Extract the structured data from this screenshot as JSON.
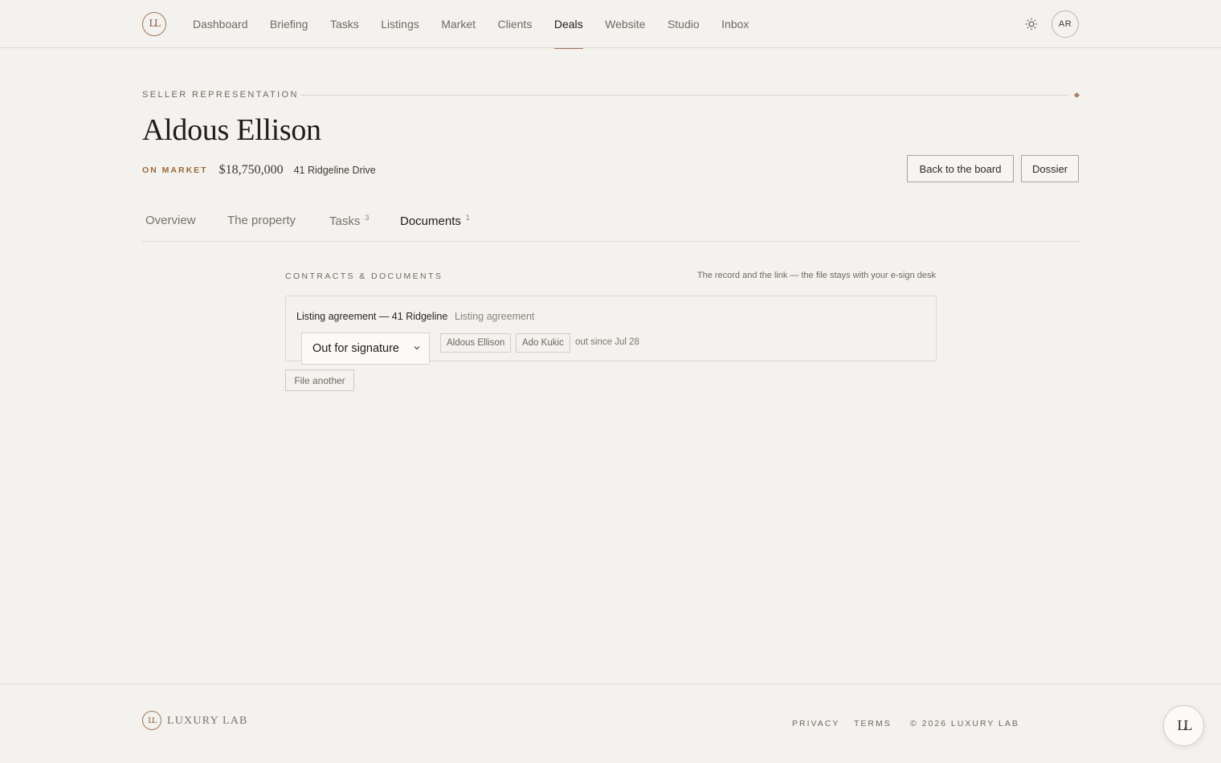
{
  "brand": {
    "mark": "LL",
    "name": "LUXURY LAB"
  },
  "nav": {
    "items": [
      {
        "label": "Dashboard"
      },
      {
        "label": "Briefing"
      },
      {
        "label": "Tasks"
      },
      {
        "label": "Listings"
      },
      {
        "label": "Market"
      },
      {
        "label": "Clients"
      },
      {
        "label": "Deals",
        "active": true
      },
      {
        "label": "Website"
      },
      {
        "label": "Studio"
      },
      {
        "label": "Inbox"
      }
    ],
    "theme_icon": "sun-icon",
    "avatar": "AR"
  },
  "header": {
    "eyebrow": "SELLER REPRESENTATION",
    "title": "Aldous Ellison",
    "status": "ON MARKET",
    "price": "$18,750,000",
    "address": "41 Ridgeline Drive",
    "back_label": "Back to the board",
    "dossier_label": "Dossier"
  },
  "tabs": [
    {
      "label": "Overview",
      "count": ""
    },
    {
      "label": "The property",
      "count": ""
    },
    {
      "label": "Tasks",
      "count": "3"
    },
    {
      "label": "Documents",
      "count": "1",
      "active": true
    }
  ],
  "documents": {
    "section_label": "CONTRACTS & DOCUMENTS",
    "note": "The record and the link — the file stays with your e-sign desk",
    "items": [
      {
        "title": "Listing agreement — 41 Ridgeline",
        "type": "Listing agreement",
        "status": "Out for signature",
        "parties": [
          "Aldous Ellison",
          "Ado Kukic"
        ],
        "since": "out since Jul 28"
      }
    ],
    "file_another_label": "File another"
  },
  "footer": {
    "privacy": "PRIVACY",
    "terms": "TERMS",
    "copyright": "© 2026 LUXURY LAB"
  },
  "fab": {
    "mark": "LL"
  },
  "colors": {
    "accent": "#a0785a",
    "background": "#f4f2ee",
    "status": "#9a6a3a"
  }
}
